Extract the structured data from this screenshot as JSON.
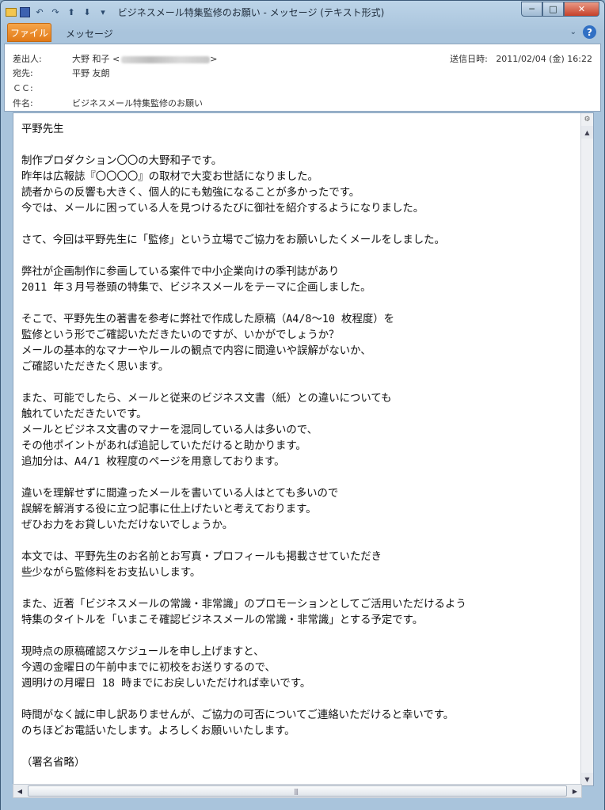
{
  "window": {
    "title": "ビジネスメール特集監修のお願い - メッセージ (テキスト形式)",
    "minimize": "─",
    "maximize": "□",
    "close": "✕"
  },
  "ribbon": {
    "file_tab": "ファイル",
    "message_tab": "メッセージ",
    "help": "?"
  },
  "header": {
    "from_label": "差出人:",
    "from_name": "大野 和子 <",
    "from_suffix": ">",
    "to_label": "宛先:",
    "to_value": "平野 友朗",
    "cc_label": "ＣＣ:",
    "cc_value": "",
    "subject_label": "件名:",
    "subject_value": "ビジネスメール特集監修のお願い",
    "sent_label": "送信日時:",
    "sent_value": "2011/02/04 (金) 16:22"
  },
  "body": {
    "lines": [
      "平野先生",
      "",
      "制作プロダクション〇〇の大野和子です。",
      "昨年は広報誌『〇〇〇〇』の取材で大変お世話になりました。",
      "読者からの反響も大きく、個人的にも勉強になることが多かったです。",
      "今では、メールに困っている人を見つけるたびに御社を紹介するようになりました。",
      "",
      "さて、今回は平野先生に「監修」という立場でご協力をお願いしたくメールをしました。",
      "",
      "弊社が企画制作に参画している案件で中小企業向けの季刊誌があり",
      "2011 年３月号巻頭の特集で、ビジネスメールをテーマに企画しました。",
      "",
      "そこで、平野先生の著書を参考に弊社で作成した原稿（A4/8～10 枚程度）を",
      "監修という形でご確認いただきたいのですが、いかがでしょうか？",
      "メールの基本的なマナーやルールの観点で内容に間違いや誤解がないか、",
      "ご確認いただきたく思います。",
      "",
      "また、可能でしたら、メールと従来のビジネス文書（紙）との違いについても",
      "触れていただきたいです。",
      "メールとビジネス文書のマナーを混同している人は多いので、",
      "その他ポイントがあれば追記していただけると助かります。",
      "追加分は、A4/1 枚程度のページを用意しております。",
      "",
      "違いを理解せずに間違ったメールを書いている人はとても多いので",
      "誤解を解消する役に立つ記事に仕上げたいと考えております。",
      "ぜひお力をお貸しいただけないでしょうか。",
      "",
      "本文では、平野先生のお名前とお写真・プロフィールも掲載させていただき",
      "些少ながら監修料をお支払いします。",
      "",
      "また、近著「ビジネスメールの常識・非常識」のプロモーションとしてご活用いただけるよう",
      "特集のタイトルを「いまこそ確認ビジネスメールの常識・非常識」とする予定です。",
      "",
      "現時点の原稿確認スケジュールを申し上げますと、",
      "今週の金曜日の午前中までに初校をお送りするので、",
      "週明けの月曜日 18 時までにお戻しいただければ幸いです。",
      "",
      "時間がなく誠に申し訳ありませんが、ご協力の可否についてご連絡いただけると幸いです。",
      "のちほどお電話いたします。よろしくお願いいたします。",
      "",
      "（署名省略）"
    ]
  },
  "icons": {
    "mail": "mail-icon",
    "save": "save-icon",
    "undo": "undo-icon",
    "redo": "redo-icon",
    "up": "up-arrow-icon",
    "down": "down-arrow-icon"
  },
  "colors": {
    "file_tab": "#e27a17",
    "help": "#3170c4",
    "close": "#c6412a"
  }
}
